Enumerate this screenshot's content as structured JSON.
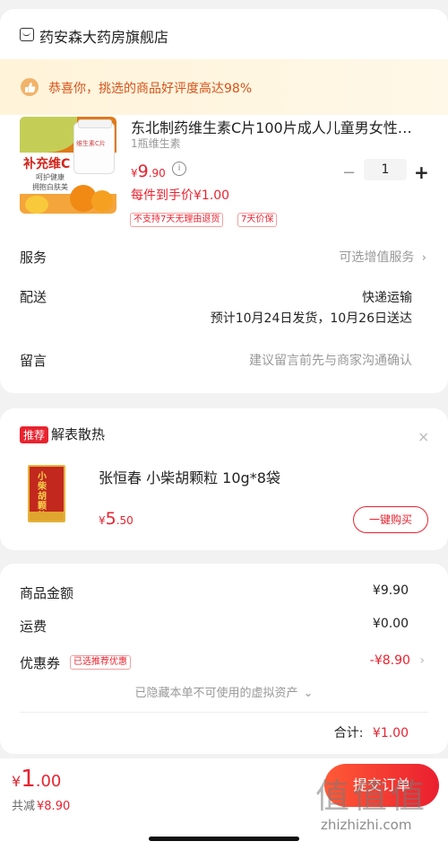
{
  "store": {
    "name": "药安森大药房旗舰店"
  },
  "banner": {
    "text": "恭喜你，挑选的商品好评度高达98%"
  },
  "product": {
    "title": "东北制药维生素C片100片成人儿童男女性…",
    "spec": "1瓶维生素",
    "price_symbol": "¥",
    "price_int": "9",
    "price_dec": ".90",
    "unit_price": "每件到手价¥1.00",
    "quantity": "1",
    "minus": "−",
    "plus": "+",
    "tags": [
      "不支持7天无理由退货",
      "7天价保"
    ],
    "image": {
      "headline": "补充维C",
      "line1": "呵护健康",
      "line2": "拥抱白肤美",
      "bottle_label": "维生素C片"
    }
  },
  "rows": {
    "service_label": "服务",
    "service_value": "可选增值服务",
    "delivery_label": "配送",
    "delivery_method": "快递运输",
    "delivery_estimate": "预计10月24日发货，10月26日送达",
    "note_label": "留言",
    "note_placeholder": "建议留言前先与商家沟通确认"
  },
  "recommend": {
    "badge": "推荐",
    "heading": "解表散热",
    "close": "×",
    "item_title": "张恒春 小柴胡颗粒 10g*8袋",
    "price_symbol": "¥",
    "price_int": "5",
    "price_dec": ".50",
    "buy_button": "一键购买",
    "box_text": "小柴胡颗粒"
  },
  "summary": {
    "goods_label": "商品金额",
    "goods_value": "¥9.90",
    "shipping_label": "运费",
    "shipping_value": "¥0.00",
    "coupon_label": "优惠券",
    "coupon_tag": "已选推荐优惠",
    "coupon_value": "-¥8.90",
    "hidden_assets": "已隐藏本单不可使用的虚拟资产",
    "total_label": "合计:",
    "total_value": "¥1.00"
  },
  "bottom": {
    "price_symbol": "¥",
    "price_int": "1",
    "price_dec": ".00",
    "saved_label": "共减",
    "saved_value": "¥8.90",
    "submit": "提交订单"
  },
  "watermark": {
    "text": "zhizhizhi.com",
    "logo": "值值值"
  },
  "colors": {
    "accent": "#e8232f",
    "banner_text": "#d6531a",
    "banner_bg": "#fff3d9"
  }
}
